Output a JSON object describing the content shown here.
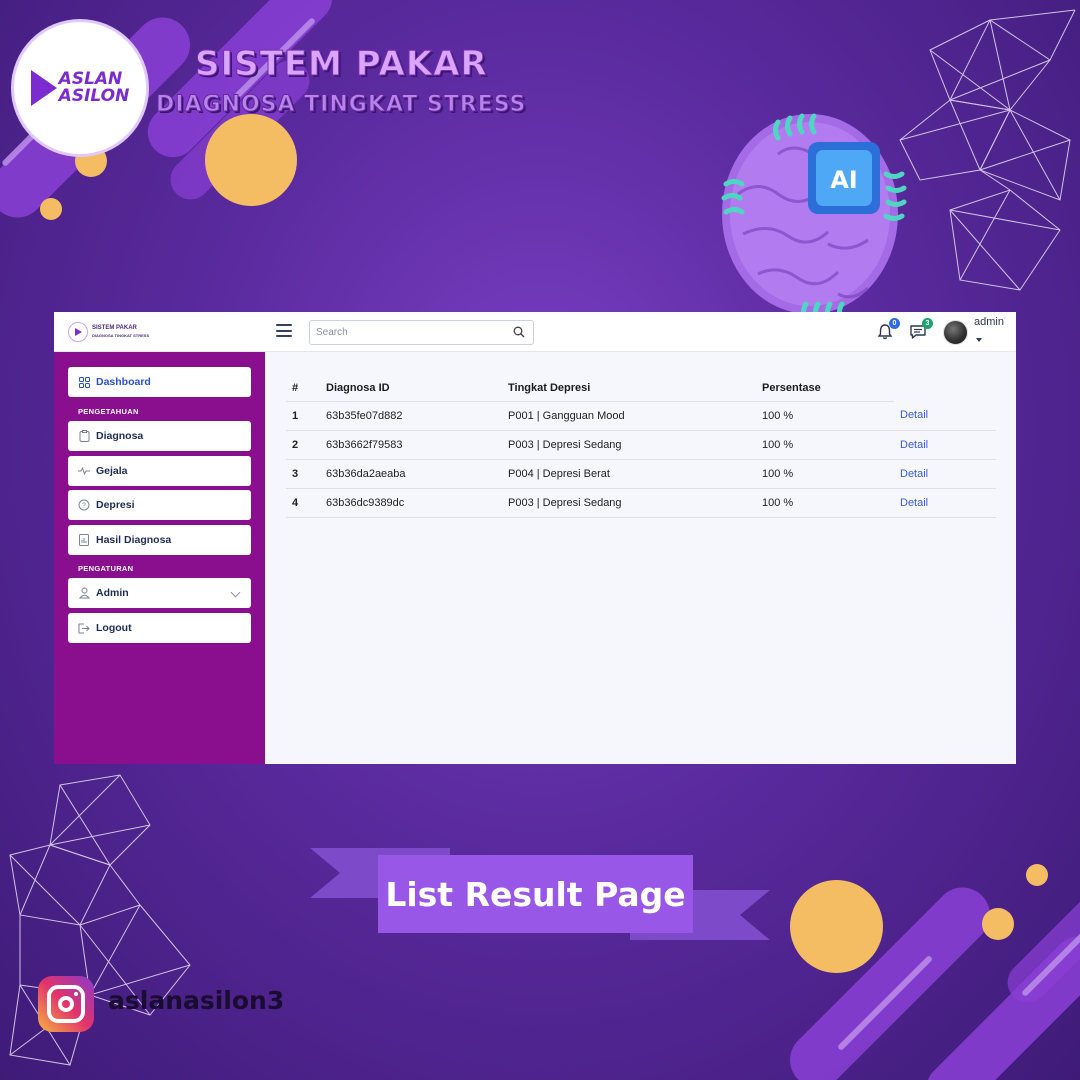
{
  "poster": {
    "logo_line1": "ASLAN",
    "logo_line2": "ASILON",
    "title": "SISTEM PAKAR",
    "subtitle": "DIAGNOSA TINGKAT STRESS",
    "brain_chip_label": "AI",
    "banner": "List Result Page",
    "instagram_handle": "aslanasilon3",
    "colors": {
      "accent_yellow": "#f4bd63",
      "banner_purple": "#9857e6",
      "sidebar_magenta": "#8a0f8e"
    }
  },
  "app": {
    "brand": {
      "title": "SISTEM PAKAR",
      "subtitle": "DIAGNOSA TINGKAT STRESS"
    },
    "search": {
      "placeholder": "Search",
      "value": ""
    },
    "notifications": {
      "count": "0"
    },
    "messages": {
      "count": "3"
    },
    "user": {
      "name": "admin"
    },
    "sidebar": {
      "dashboard": "Dashboard",
      "section_pengetahuan": "PENGETAHUAN",
      "diagnosa": "Diagnosa",
      "gejala": "Gejala",
      "depresi": "Depresi",
      "hasil_diagnosa": "Hasil Diagnosa",
      "section_pengaturan": "PENGATURAN",
      "admin": "Admin",
      "logout": "Logout"
    },
    "table": {
      "columns": [
        "#",
        "Diagnosa ID",
        "Tingkat Depresi",
        "Persentase",
        ""
      ],
      "rows": [
        {
          "no": "1",
          "id": "63b35fe07d882",
          "tingkat": "P001 | Gangguan Mood",
          "persen": "100 %",
          "action": "Detail"
        },
        {
          "no": "2",
          "id": "63b3662f79583",
          "tingkat": "P003 | Depresi Sedang",
          "persen": "100 %",
          "action": "Detail"
        },
        {
          "no": "3",
          "id": "63b36da2aeaba",
          "tingkat": "P004 | Depresi Berat",
          "persen": "100 %",
          "action": "Detail"
        },
        {
          "no": "4",
          "id": "63b36dc9389dc",
          "tingkat": "P003 | Depresi Sedang",
          "persen": "100 %",
          "action": "Detail"
        }
      ]
    }
  }
}
